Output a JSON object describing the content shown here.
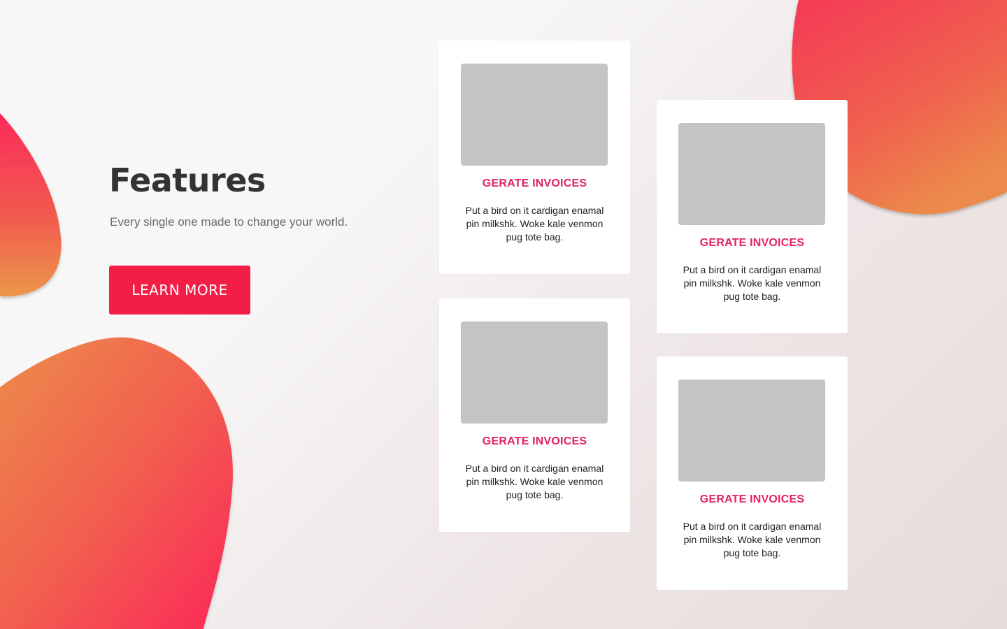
{
  "colors": {
    "accent": "#f21e46",
    "card_title": "#e4215f",
    "blob_gradient_start": "#fb2a5a",
    "blob_gradient_end": "#ec914a",
    "thumbnail": "#c4c4c4"
  },
  "hero": {
    "title": "Features",
    "subtitle": "Every single one made to change your world.",
    "button_label": "LEARN MORE"
  },
  "cards": [
    {
      "title": "GERATE INVOICES",
      "text": "Put a bird on it cardigan enamal pin milkshk. Woke kale venmon pug tote bag."
    },
    {
      "title": "GERATE INVOICES",
      "text": "Put a bird on it cardigan enamal pin milkshk. Woke kale venmon pug tote bag."
    },
    {
      "title": "GERATE INVOICES",
      "text": "Put a bird on it cardigan enamal pin milkshk. Woke kale venmon pug tote bag."
    },
    {
      "title": "GERATE INVOICES",
      "text": "Put a bird on it cardigan enamal pin milkshk. Woke kale venmon pug tote bag."
    }
  ]
}
